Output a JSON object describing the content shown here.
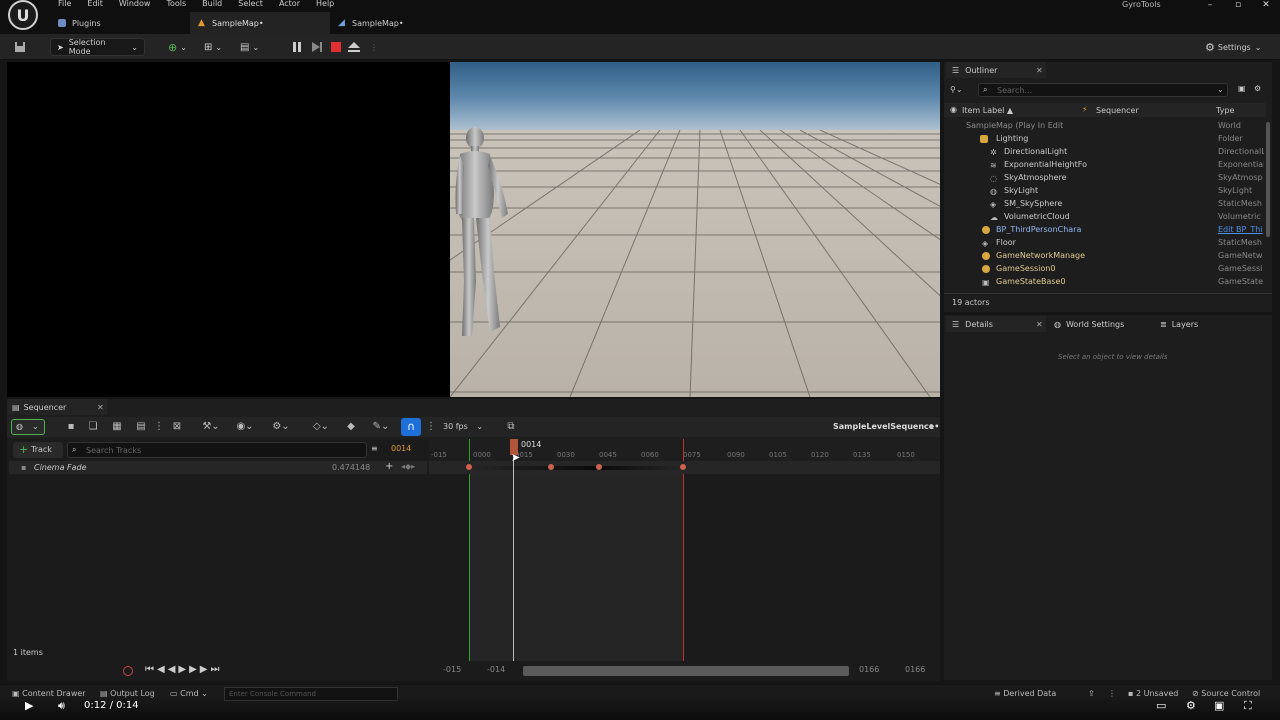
{
  "menu": {
    "items": [
      "File",
      "Edit",
      "Window",
      "Tools",
      "Build",
      "Select",
      "Actor",
      "Help"
    ],
    "app_title": "GyroTools",
    "logo_glyph": "U"
  },
  "tabs": [
    {
      "label": "Plugins"
    },
    {
      "label": "SampleMap•"
    },
    {
      "label": "SampleMap•"
    }
  ],
  "toolbar": {
    "selection_mode": "Selection Mode",
    "settings": "Settings"
  },
  "outliner": {
    "title": "Outliner",
    "search_placeholder": "Search...",
    "columns": {
      "label": "Item Label ▲",
      "sequencer": "Sequencer",
      "type": "Type"
    },
    "rows": [
      {
        "label": "SampleMap (Play In Edit",
        "type": "World"
      },
      {
        "label": "Lighting",
        "type": "Folder"
      },
      {
        "label": "DirectionalLight",
        "type": "DirectionalL"
      },
      {
        "label": "ExponentialHeightFo",
        "type": "Exponential"
      },
      {
        "label": "SkyAtmosphere",
        "type": "SkyAtmosp"
      },
      {
        "label": "SkyLight",
        "type": "SkyLight"
      },
      {
        "label": "SM_SkySphere",
        "type": "StaticMesh"
      },
      {
        "label": "VolumetricCloud",
        "type": "Volumetric"
      },
      {
        "label": "BP_ThirdPersonChara",
        "type": "Edit BP_Thi"
      },
      {
        "label": "Floor",
        "type": "StaticMesh"
      },
      {
        "label": "GameNetworkManage",
        "type": "GameNetw"
      },
      {
        "label": "GameSession0",
        "type": "GameSessi"
      },
      {
        "label": "GameStateBase0",
        "type": "GameState"
      }
    ],
    "count": "19 actors"
  },
  "details": {
    "tab_details": "Details",
    "tab_world": "World Settings",
    "tab_layers": "Layers",
    "empty": "Select an object to view details"
  },
  "sequencer": {
    "title": "Sequencer",
    "fps": "30 fps",
    "sequence_name": "SampleLevelSequence•",
    "track_button": "Track",
    "search_placeholder": "Search Tracks",
    "current_frame": "0014",
    "playhead_label": "0014",
    "track_name": "Cinema Fade",
    "track_value": "0.474148",
    "items_count": "1 items",
    "ticks": [
      "-015",
      "0000",
      "0015",
      "0030",
      "0045",
      "0060",
      "0075",
      "0090",
      "0105",
      "0120",
      "0135",
      "0150"
    ],
    "range_start": "-015",
    "range_start2": "-014",
    "range_end": "0166",
    "range_end2": "0166"
  },
  "bottom": {
    "content_drawer": "Content Drawer",
    "output_log": "Output Log",
    "cmd": "Cmd",
    "console_placeholder": "Enter Console Command",
    "derived_data": "Derived Data",
    "unsaved": "2 Unsaved",
    "source_control": "Source Control"
  },
  "video": {
    "time": "0:12 / 0:14"
  },
  "colors": {
    "accent_blue": "#1f6fd8",
    "playhead": "#b0553a",
    "stop_red": "#e03030",
    "folder": "#d8a640"
  }
}
